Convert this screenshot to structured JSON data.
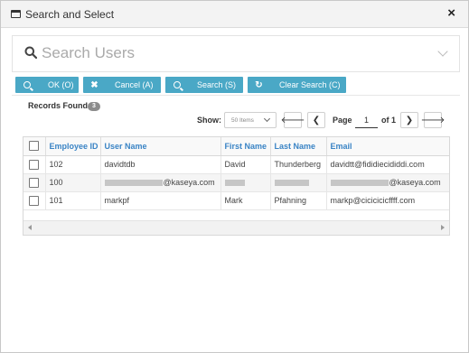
{
  "window": {
    "title": "Search and Select",
    "close": "×"
  },
  "search": {
    "placeholder": "Search Users"
  },
  "toolbar": {
    "ok_label": "OK (O)",
    "cancel_label": "Cancel (A)",
    "search_label": "Search (S)",
    "clear_label": "Clear Search (C)"
  },
  "records": {
    "label": "Records Found:",
    "count": "3"
  },
  "paging": {
    "show_label": "Show:",
    "page_size": "50 Items",
    "page_label": "Page",
    "current_page": "1",
    "of_label": "of 1"
  },
  "table": {
    "columns": [
      "Employee ID",
      "User Name",
      "First Name",
      "Last Name",
      "Email"
    ],
    "rows": [
      {
        "id": "102",
        "username": "davidtdb",
        "first": "David",
        "last": "Thunderberg",
        "email": "davidtt@fididiecididdi.com"
      },
      {
        "id": "100",
        "username": "@kaseya.com",
        "first": "",
        "last": "",
        "email": "@kaseya.com"
      },
      {
        "id": "101",
        "username": "markpf",
        "first": "Mark",
        "last": "Pfahning",
        "email": "markp@cicicicicffff.com"
      }
    ]
  },
  "colors": {
    "accent": "#4aa8c6",
    "header_text": "#3a84c5"
  }
}
